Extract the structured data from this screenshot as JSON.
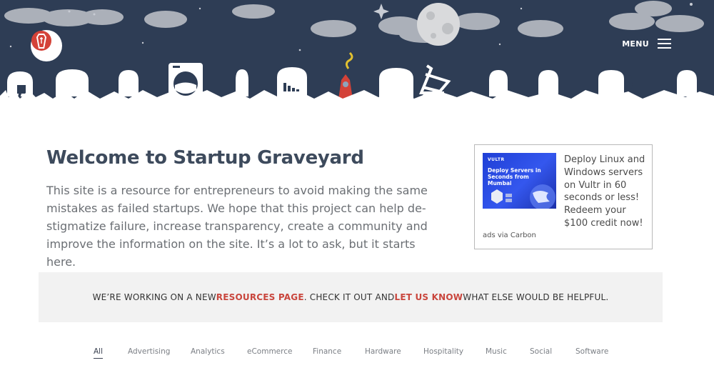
{
  "header": {
    "menu_label": "MENU"
  },
  "welcome": {
    "title": "Welcome to Startup Graveyard",
    "body": "This site is a resource for entrepreneurs to avoid making the same mistakes as failed startups. We hope that this project can help de-stigmatize failure, increase transparency, create a community and improve the information on the site. It’s a lot to ask, but it starts here."
  },
  "ad": {
    "image_brand": "VULTR",
    "image_headline": "Deploy Servers in Seconds from Mumbai",
    "text": "Deploy Linux and Windows servers on Vultr in 60 seconds or less! Redeem your $100 credit now!",
    "via": "ads via Carbon"
  },
  "banner": {
    "part1": "WE’RE WORKING ON A NEW ",
    "link1": "RESOURCES PAGE",
    "part2": ". CHECK IT OUT AND ",
    "link2": "LET US KNOW",
    "part3": " WHAT ELSE WOULD BE HELPFUL."
  },
  "filters": [
    "All",
    "Advertising",
    "Analytics",
    "eCommerce",
    "Finance",
    "Hardware",
    "Hospitality",
    "Music",
    "Social",
    "Software"
  ],
  "colors": {
    "sky": "#2e3d55",
    "accent_red": "#c9463d",
    "title_color": "#3d4a5c"
  }
}
